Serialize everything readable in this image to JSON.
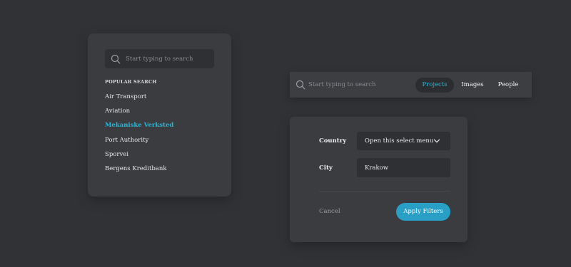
{
  "search_panel": {
    "placeholder": "Start typing to search",
    "section_title": "POPULAR SEARCH",
    "items": [
      {
        "label": "Air Transport"
      },
      {
        "label": "Aviation"
      },
      {
        "label": "Mekaniske Verksted"
      },
      {
        "label": "Port Authority"
      },
      {
        "label": "Sporvei"
      },
      {
        "label": "Bergens Kreditbank"
      }
    ],
    "active_index": 2
  },
  "search_bar": {
    "placeholder": "Start typing to search",
    "tabs": [
      {
        "label": "Projects"
      },
      {
        "label": "Images"
      },
      {
        "label": "People"
      }
    ],
    "active_tab": "Projects"
  },
  "filter_panel": {
    "country_label": "Country",
    "country_select_value": "Open this select menu",
    "city_label": "City",
    "city_value": "Krakow",
    "cancel_label": "Cancel",
    "apply_label": "Apply Filters"
  },
  "colors": {
    "background": "#313235",
    "panel": "#3b3c3f",
    "input": "#2f3033",
    "accent": "#2ab6d6",
    "button": "#2a9fc6"
  },
  "icons": {
    "search": "search-icon",
    "chevron": "chevron-down-icon"
  }
}
